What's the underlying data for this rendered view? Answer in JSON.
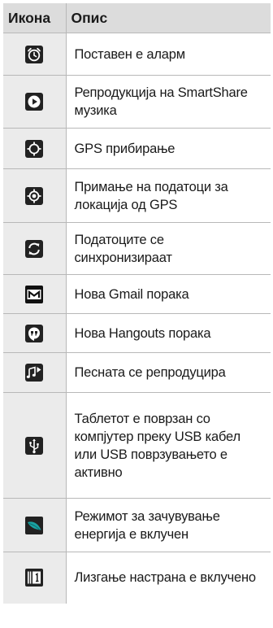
{
  "table": {
    "headers": {
      "icon": "Икона",
      "description": "Опис"
    },
    "rows": [
      {
        "icon": "alarm-clock-icon",
        "description": "Поставен е аларм"
      },
      {
        "icon": "smartshare-play-icon",
        "description": "Репродукција на SmartShare музика"
      },
      {
        "icon": "gps-acquiring-icon",
        "description": "GPS прибирање"
      },
      {
        "icon": "gps-location-icon",
        "description": "Примање на податоци за локација од GPS"
      },
      {
        "icon": "sync-icon",
        "description": "Податоците се синхронизираат"
      },
      {
        "icon": "gmail-icon",
        "description": "Нова Gmail порака"
      },
      {
        "icon": "hangouts-icon",
        "description": "Нова Hangouts порака"
      },
      {
        "icon": "music-playing-icon",
        "description": "Песната се репродуцира"
      },
      {
        "icon": "usb-icon",
        "description": "Таблетот е поврзан со компјутер преку USB кабел или USB поврзувањето е активно"
      },
      {
        "icon": "energy-saver-icon",
        "description": "Режимот за зачувување енергија е вклучен"
      },
      {
        "icon": "slide-aside-icon",
        "description": "Лизгање настрана е вклучено"
      }
    ]
  }
}
